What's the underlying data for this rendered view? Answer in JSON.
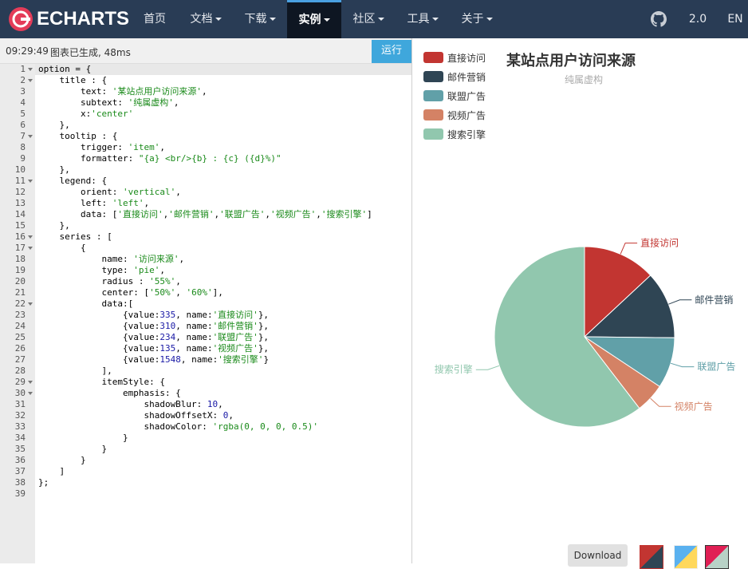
{
  "nav": {
    "brand": "ECHARTS",
    "items": [
      {
        "label": "首页",
        "caret": false,
        "active": false
      },
      {
        "label": "文档",
        "caret": true,
        "active": false
      },
      {
        "label": "下载",
        "caret": true,
        "active": false
      },
      {
        "label": "实例",
        "caret": true,
        "active": true
      },
      {
        "label": "社区",
        "caret": true,
        "active": false
      },
      {
        "label": "工具",
        "caret": true,
        "active": false
      },
      {
        "label": "关于",
        "caret": true,
        "active": false
      }
    ],
    "version": "2.0",
    "lang": "EN"
  },
  "status": {
    "time": "09:29:49",
    "message": "图表已生成, 48ms",
    "run_label": "运行"
  },
  "code_lines": [
    "option = {",
    "    title : {",
    "        text: '某站点用户访问来源',",
    "        subtext: '纯属虚构',",
    "        x:'center'",
    "    },",
    "    tooltip : {",
    "        trigger: 'item',",
    "        formatter: \"{a} <br/>{b} : {c} ({d}%)\"",
    "    },",
    "    legend: {",
    "        orient: 'vertical',",
    "        left: 'left',",
    "        data: ['直接访问','邮件营销','联盟广告','视频广告','搜索引擎']",
    "    },",
    "    series : [",
    "        {",
    "            name: '访问来源',",
    "            type: 'pie',",
    "            radius : '55%',",
    "            center: ['50%', '60%'],",
    "            data:[",
    "                {value:335, name:'直接访问'},",
    "                {value:310, name:'邮件营销'},",
    "                {value:234, name:'联盟广告'},",
    "                {value:135, name:'视频广告'},",
    "                {value:1548, name:'搜索引擎'}",
    "            ],",
    "            itemStyle: {",
    "                emphasis: {",
    "                    shadowBlur: 10,",
    "                    shadowOffsetX: 0,",
    "                    shadowColor: 'rgba(0, 0, 0, 0.5)'",
    "                }",
    "            }",
    "        }",
    "    ]",
    "};",
    ""
  ],
  "fold_lines": [
    1,
    2,
    7,
    11,
    16,
    17,
    22,
    29,
    30
  ],
  "chart_data": {
    "type": "pie",
    "title": "某站点用户访问来源",
    "subtitle": "纯属虚构",
    "legend_position": "top-left",
    "slices": [
      {
        "name": "直接访问",
        "value": 335,
        "color": "#c23531"
      },
      {
        "name": "邮件营销",
        "value": 310,
        "color": "#2f4554"
      },
      {
        "name": "联盟广告",
        "value": 234,
        "color": "#61a0a8"
      },
      {
        "name": "视频广告",
        "value": 135,
        "color": "#d48265"
      },
      {
        "name": "搜索引擎",
        "value": 1548,
        "color": "#91c7ae"
      }
    ]
  },
  "download_label": "Download"
}
